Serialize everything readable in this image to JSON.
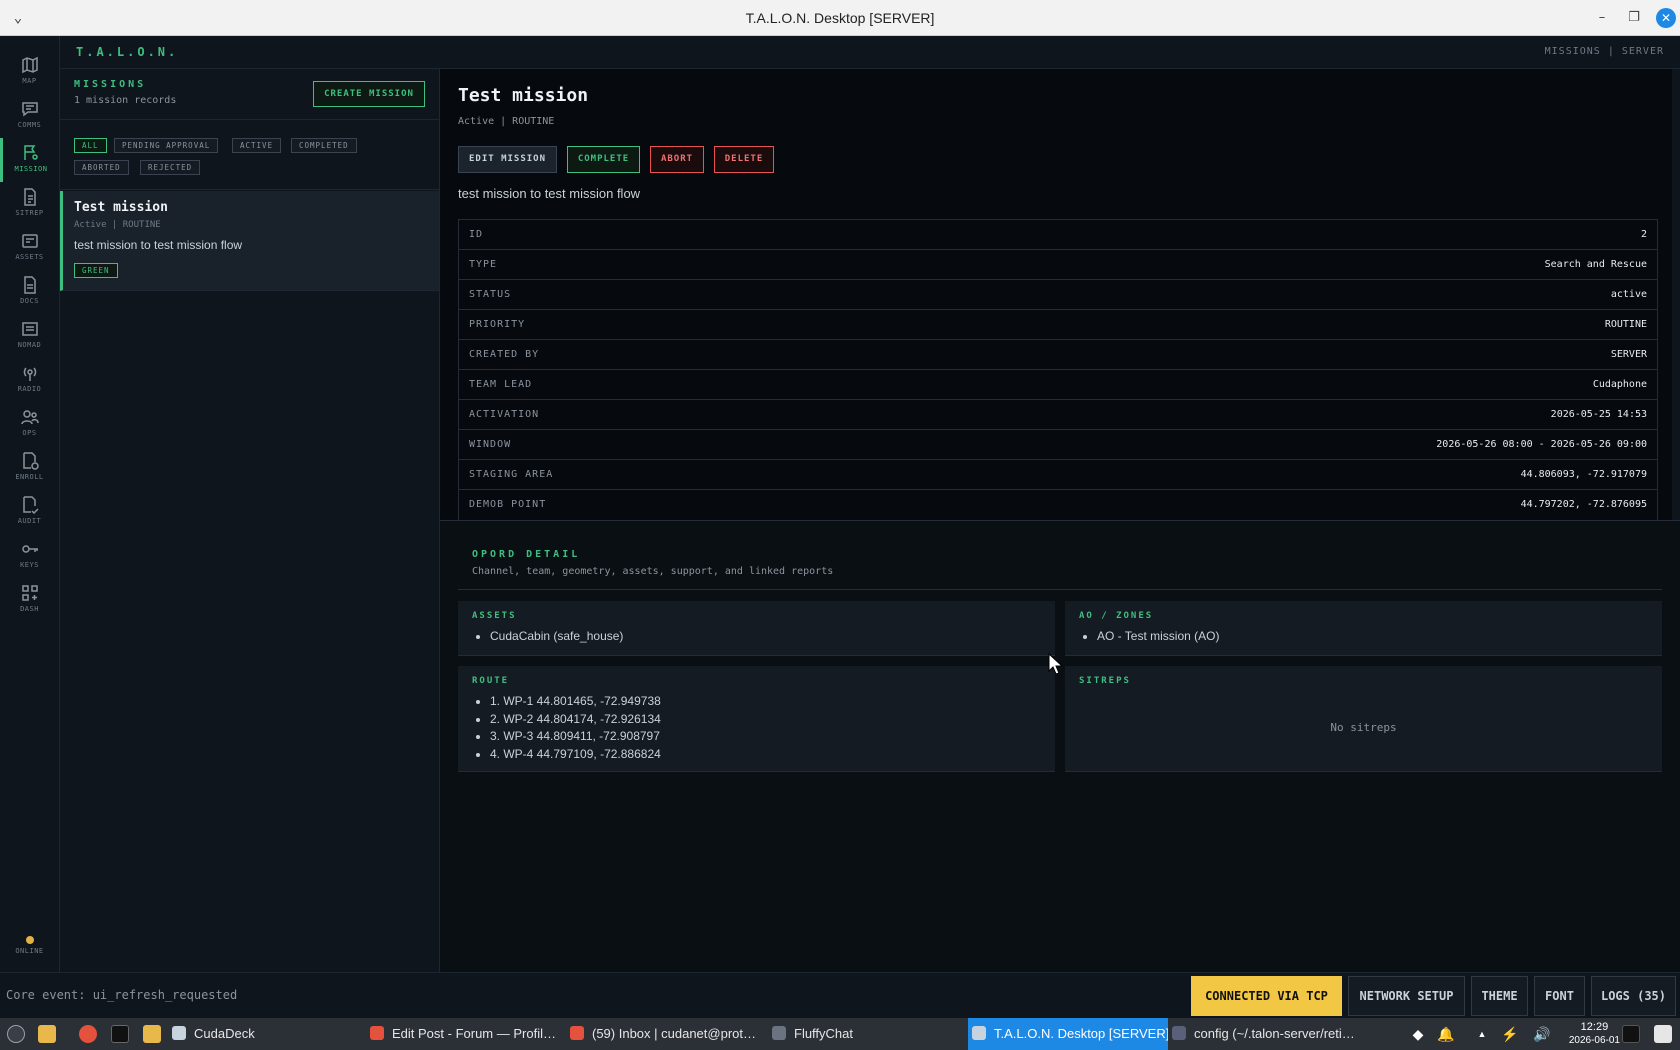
{
  "window": {
    "title": "T.A.L.O.N. Desktop [SERVER]"
  },
  "header": {
    "brand": "T.A.L.O.N.",
    "breadcrumb": "MISSIONS | SERVER"
  },
  "rail": {
    "items": [
      {
        "label": "MAP",
        "icon": "map-icon"
      },
      {
        "label": "COMMS",
        "icon": "chat-icon"
      },
      {
        "label": "MISSION",
        "icon": "flag-icon",
        "active": true
      },
      {
        "label": "SITREP",
        "icon": "report-icon"
      },
      {
        "label": "ASSETS",
        "icon": "assets-icon"
      },
      {
        "label": "DOCS",
        "icon": "docs-icon"
      },
      {
        "label": "NOMAD",
        "icon": "nomad-icon"
      },
      {
        "label": "RADIO",
        "icon": "radio-icon"
      },
      {
        "label": "OPS",
        "icon": "ops-icon"
      },
      {
        "label": "ENROLL",
        "icon": "enroll-icon"
      },
      {
        "label": "AUDIT",
        "icon": "audit-icon"
      },
      {
        "label": "KEYS",
        "icon": "key-icon"
      },
      {
        "label": "DASH",
        "icon": "dash-icon"
      }
    ],
    "status": "ONLINE"
  },
  "missions": {
    "title": "MISSIONS",
    "count": "1 mission records",
    "create_label": "CREATE MISSION",
    "filters": [
      "ALL",
      "PENDING APPROVAL",
      "ACTIVE",
      "COMPLETED",
      "ABORTED",
      "REJECTED"
    ],
    "items": [
      {
        "title": "Test mission",
        "status": "Active | ROUTINE",
        "desc": "test mission to test mission flow",
        "badge": "GREEN"
      }
    ]
  },
  "detail": {
    "title": "Test mission",
    "subtitle": "Active | ROUTINE",
    "actions": {
      "edit": "EDIT MISSION",
      "complete": "COMPLETE",
      "abort": "ABORT",
      "delete": "DELETE"
    },
    "description": "test mission to test mission flow",
    "fields": [
      {
        "key": "ID",
        "value": "2"
      },
      {
        "key": "TYPE",
        "value": "Search and Rescue"
      },
      {
        "key": "STATUS",
        "value": "active"
      },
      {
        "key": "PRIORITY",
        "value": "ROUTINE"
      },
      {
        "key": "CREATED BY",
        "value": "SERVER"
      },
      {
        "key": "TEAM LEAD",
        "value": "Cudaphone"
      },
      {
        "key": "ACTIVATION",
        "value": "2026-05-25 14:53"
      },
      {
        "key": "WINDOW",
        "value": "2026-05-26 08:00 - 2026-05-26 09:00"
      },
      {
        "key": "STAGING AREA",
        "value": "44.806093, -72.917079"
      },
      {
        "key": "DEMOB POINT",
        "value": "44.797202, -72.876095"
      }
    ]
  },
  "opord": {
    "title": "OPORD DETAIL",
    "subtitle": "Channel, team, geometry, assets, support, and linked reports",
    "assets": {
      "title": "ASSETS",
      "items": [
        "CudaCabin (safe_house)"
      ]
    },
    "zones": {
      "title": "AO / ZONES",
      "items": [
        "AO - Test mission (AO)"
      ]
    },
    "route": {
      "title": "ROUTE",
      "items": [
        "1. WP-1 44.801465, -72.949738",
        "2. WP-2 44.804174, -72.926134",
        "3. WP-3 44.809411, -72.908797",
        "4. WP-4 44.797109, -72.886824"
      ]
    },
    "sitreps": {
      "title": "SITREPS",
      "empty": "No sitreps"
    }
  },
  "statusbar": {
    "event": "Core event: ui_refresh_requested",
    "connection": "CONNECTED VIA TCP",
    "network": "NETWORK SETUP",
    "theme": "THEME",
    "font": "FONT",
    "logs": "LOGS (35)"
  },
  "taskbar": {
    "tasks": [
      {
        "label": "CudaDeck"
      },
      {
        "label": "Edit Post - Forum — Profil…"
      },
      {
        "label": "(59) Inbox | cudanet@prot…"
      },
      {
        "label": "FluffyChat"
      },
      {
        "label": "T.A.L.O.N. Desktop [SERVER]",
        "active": true
      },
      {
        "label": "config (~/.talon-server/reti…"
      }
    ],
    "time": "12:29",
    "date": "2026-06-01"
  },
  "colors": {
    "accent": "#3fbf7f",
    "danger": "#e55353",
    "warning": "#f2c744",
    "taskbar_active": "#1e88e5"
  }
}
